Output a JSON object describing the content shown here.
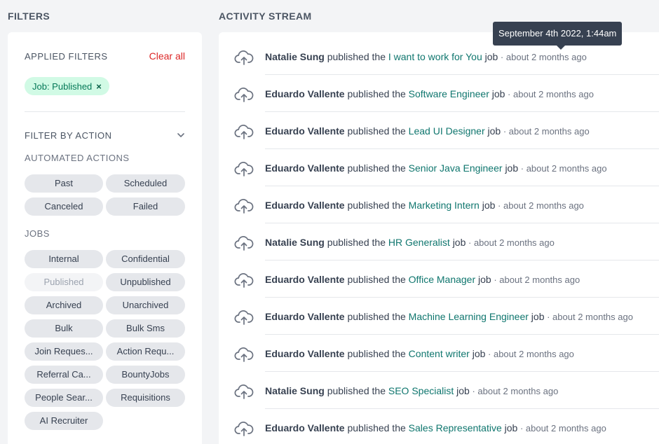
{
  "filters": {
    "title": "FILTERS",
    "applied_label": "APPLIED FILTERS",
    "clear_all": "Clear all",
    "applied_chip": "Job: Published",
    "applied_chip_remove": "×",
    "filter_by_action": "FILTER BY ACTION",
    "automated_actions_label": "AUTOMATED ACTIONS",
    "automated_actions": [
      {
        "label": "Past"
      },
      {
        "label": "Scheduled"
      },
      {
        "label": "Canceled"
      },
      {
        "label": "Failed"
      }
    ],
    "jobs_label": "JOBS",
    "jobs": [
      {
        "label": "Internal"
      },
      {
        "label": "Confidential"
      },
      {
        "label": "Published",
        "state": "selected"
      },
      {
        "label": "Unpublished"
      },
      {
        "label": "Archived"
      },
      {
        "label": "Unarchived"
      },
      {
        "label": "Bulk"
      },
      {
        "label": "Bulk Sms"
      },
      {
        "label": "Join Reques..."
      },
      {
        "label": "Action Requ..."
      },
      {
        "label": "Referral Ca..."
      },
      {
        "label": "BountyJobs"
      },
      {
        "label": "People Sear..."
      },
      {
        "label": "Requisitions"
      },
      {
        "label": "AI Recruiter"
      }
    ]
  },
  "stream": {
    "title": "ACTIVITY STREAM",
    "tooltip": "September 4th 2022, 1:44am",
    "verb": "published the",
    "suffix": "job",
    "items": [
      {
        "actor": "Natalie Sung",
        "job": "I want to work for You",
        "time": "about 2 months ago"
      },
      {
        "actor": "Eduardo Vallente",
        "job": "Software Engineer",
        "time": "about 2 months ago"
      },
      {
        "actor": "Eduardo Vallente",
        "job": "Lead UI Designer",
        "time": "about 2 months ago"
      },
      {
        "actor": "Eduardo Vallente",
        "job": "Senior Java Engineer",
        "time": "about 2 months ago"
      },
      {
        "actor": "Eduardo Vallente",
        "job": "Marketing Intern",
        "time": "about 2 months ago"
      },
      {
        "actor": "Natalie Sung",
        "job": "HR Generalist",
        "time": "about 2 months ago"
      },
      {
        "actor": "Eduardo Vallente",
        "job": "Office Manager",
        "time": "about 2 months ago"
      },
      {
        "actor": "Eduardo Vallente",
        "job": "Machine Learning Engineer",
        "time": "about 2 months ago"
      },
      {
        "actor": "Eduardo Vallente",
        "job": "Content writer",
        "time": "about 2 months ago"
      },
      {
        "actor": "Natalie Sung",
        "job": "SEO Specialist",
        "time": "about 2 months ago"
      },
      {
        "actor": "Eduardo Vallente",
        "job": "Sales Representative",
        "time": "about 2 months ago"
      }
    ]
  },
  "colors": {
    "accent_green": "#0f766e",
    "clear_red": "#dc2626",
    "chip_bg": "#e5e7eb",
    "applied_chip_bg": "#d1fae5"
  },
  "icons": {
    "stream_item": "cloud-upload-icon",
    "filter_toggle": "chevron-down-icon",
    "chip_remove": "close-icon"
  }
}
